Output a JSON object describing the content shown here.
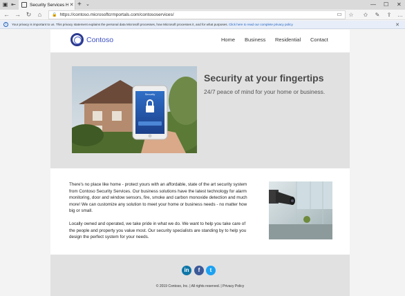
{
  "browser": {
    "tab_title": "Security Services Home",
    "tab_close": "✕",
    "new_tab": "+",
    "url": "https://contoso.microsoftcrmportals.com/contososervices/",
    "infobar_message": "Your privacy is important to us. This privacy statement explains the personal data Microsoft processes, how Microsoft processes it, and for what purposes.",
    "infobar_link": "Click here to read our complete privacy policy",
    "infobar_close": "✕"
  },
  "site": {
    "logo_text": "Contoso",
    "nav": [
      "Home",
      "Business",
      "Residential",
      "Contact"
    ]
  },
  "hero": {
    "title": "Security at your fingertips",
    "subtitle": "24/7 peace of mind for your home or business.",
    "phone_label": "Security"
  },
  "content": {
    "paragraph1": "There's no place like home - protect yours with an affordable, state of the art security system from Contoso Security Services. Our business solutions have the latest technology for alarm monitoring, door and window sensors, fire, smoke and carbon monoxide detection and much more! We can customize any solution to meet your home or business needs - no matter how big or small.",
    "paragraph2": "Locally owned and operated, we take pride in what we do. We want to help you take care of the people and property you value most. Our security specialists are standing by to help you design the perfect system for your needs."
  },
  "footer": {
    "social": [
      "in",
      "f",
      "t"
    ],
    "copyright": "© 2019 Contoso, Inc. | All rights reserved. |",
    "privacy_link": "Privacy Policy"
  },
  "colors": {
    "linkedin": "#0e76a8",
    "facebook": "#3b5998",
    "twitter": "#1da1f2",
    "brand": "#2b3a8f"
  }
}
